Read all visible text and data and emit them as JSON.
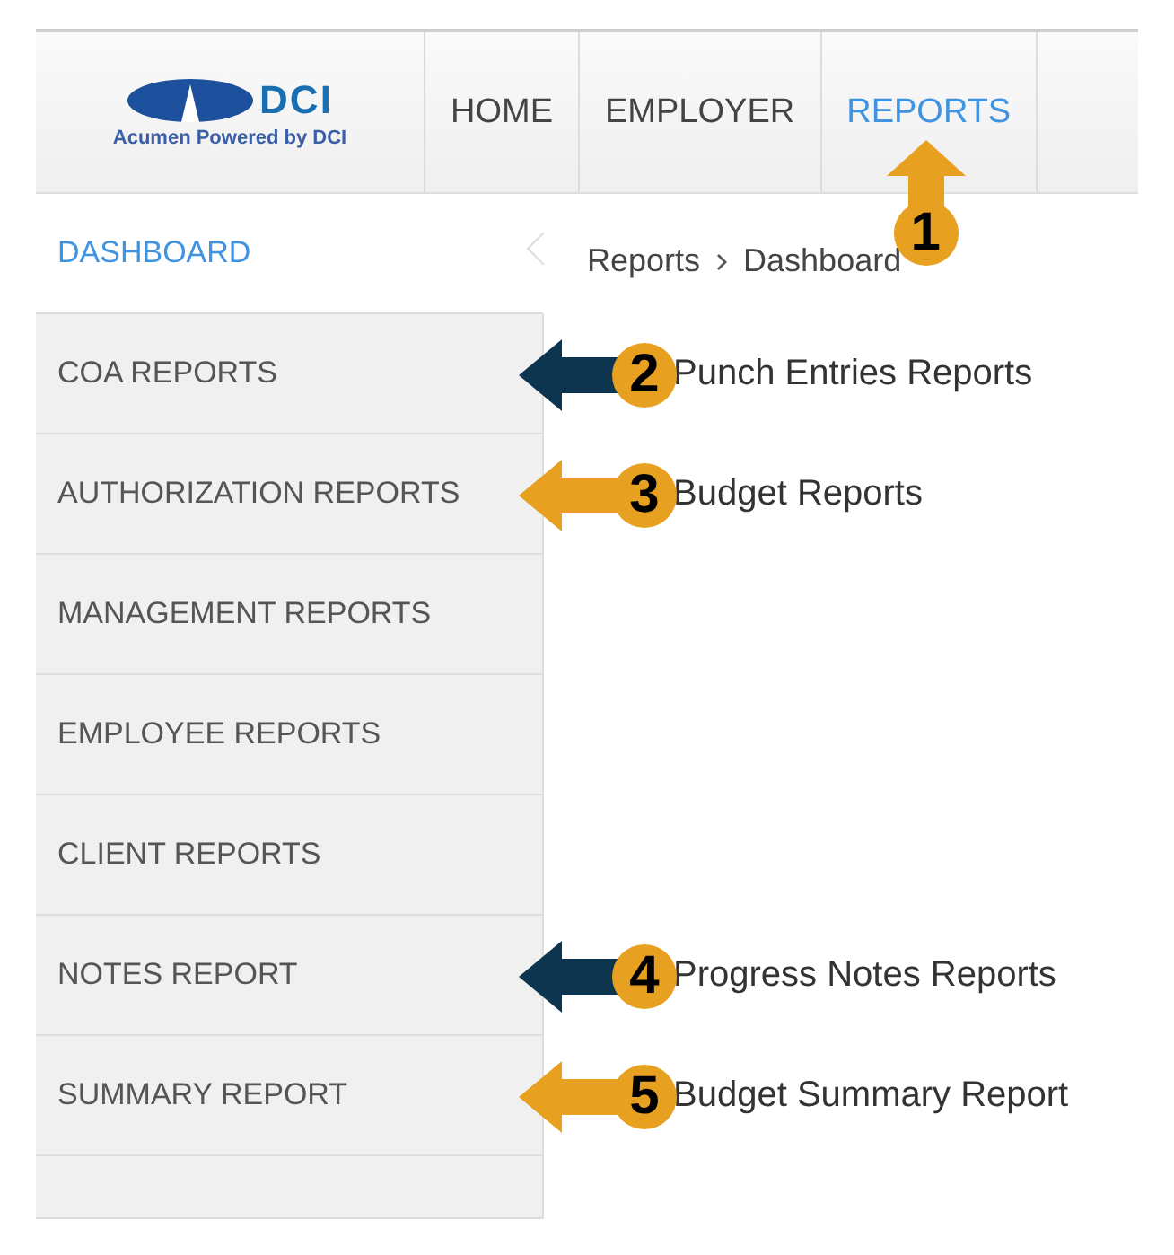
{
  "logo": {
    "mark": "DCI",
    "tagline": "Acumen Powered by DCI"
  },
  "nav": [
    {
      "label": "HOME",
      "selected": false
    },
    {
      "label": "EMPLOYER",
      "selected": false
    },
    {
      "label": "REPORTS",
      "selected": true,
      "callout": {
        "number": "1",
        "color": "#e8a020",
        "kind": "up"
      }
    }
  ],
  "breadcrumb": [
    "Reports",
    "Dashboard"
  ],
  "sidebar": {
    "items": [
      {
        "label": "DASHBOARD",
        "selected": true
      },
      {
        "label": "COA REPORTS",
        "selected": false,
        "callout": {
          "number": "2",
          "label": "Punch Entries Reports",
          "color": "#0d3550",
          "kind": "left"
        }
      },
      {
        "label": "AUTHORIZATION REPORTS",
        "selected": false,
        "callout": {
          "number": "3",
          "label": "Budget Reports",
          "color": "#e8a020",
          "kind": "left"
        }
      },
      {
        "label": "MANAGEMENT REPORTS",
        "selected": false
      },
      {
        "label": "EMPLOYEE REPORTS",
        "selected": false
      },
      {
        "label": "CLIENT REPORTS",
        "selected": false
      },
      {
        "label": "NOTES REPORT",
        "selected": false,
        "callout": {
          "number": "4",
          "label": "Progress Notes Reports",
          "color": "#0d3550",
          "kind": "left"
        }
      },
      {
        "label": "SUMMARY REPORT",
        "selected": false,
        "callout": {
          "number": "5",
          "label": "Budget Summary Report",
          "color": "#e8a020",
          "kind": "left"
        }
      }
    ]
  }
}
